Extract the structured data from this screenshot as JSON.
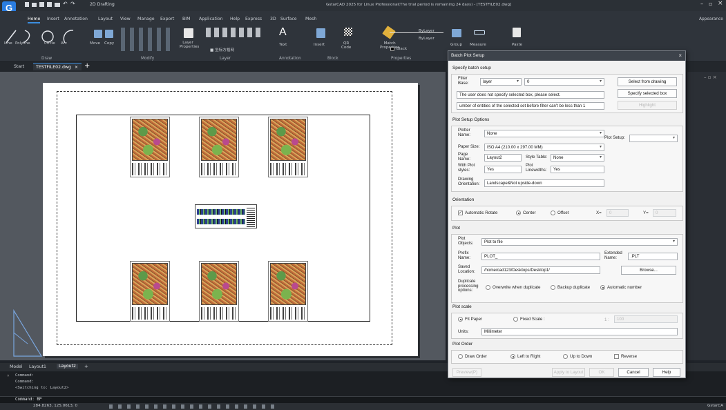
{
  "app": {
    "title": "GstarCAD 2025 for Linux Professional(The trial period is remaining 24 days) - [TESTFILE02.dwg]",
    "workspace": "2D Drafting",
    "appearance_label": "Appearance"
  },
  "ribbon": {
    "tabs": [
      "Home",
      "Insert",
      "Annotation",
      "Layout",
      "View",
      "Manage",
      "Export",
      "BIM",
      "Application",
      "Help",
      "Express",
      "3D",
      "Surface",
      "Mesh"
    ],
    "draw_tools": [
      "Line",
      "Polyline",
      "Circle",
      "Arc"
    ],
    "modify_tools": [
      "Move",
      "Copy"
    ],
    "layer_label": "Layer\nProperties",
    "layer_current": "■ 坐标方格网",
    "text_label": "Text",
    "insert_label": "Insert",
    "qr_label": "QR\nCode",
    "match_label": "Match\nProperties",
    "group_label": "Group",
    "measure_label": "Measure",
    "paste_label": "Paste",
    "bylayer_1": "ByLayer",
    "bylayer_2": "ByLayer",
    "color_value": "Black",
    "groups": [
      "Draw",
      "Modify",
      "Layer",
      "Annotation",
      "Block",
      "Properties"
    ]
  },
  "doctabs": {
    "start": "Start",
    "file": "TESTFILE02.dwg",
    "close": "×",
    "add": "+"
  },
  "layout_tabs": [
    "Model",
    "Layout1",
    "Layout2",
    "+"
  ],
  "command": {
    "history": [
      "Command:",
      "Command:",
      "<Switching to: Layout2>"
    ],
    "prompt": "Command: BP"
  },
  "status": {
    "coords": "284.8263, 125.0613, 0",
    "brand": "GstarCA"
  },
  "dialog": {
    "title": "Batch Plot Setup",
    "close": "×",
    "specify_section": "Specify batch setup",
    "filter_base_label": "Filter\nBase:",
    "filter_base_value": "layer",
    "filter_value": "0",
    "select_from_drawing": "Select from drawing",
    "specify_selected_box": "Specify selected box",
    "highlight": "Highlight",
    "message_1": "The user does not specify selected box, please select.",
    "message_2": "umber of entities of the selected set before filter can't be less than 1",
    "plot_setup_section": "Plot Setup Options",
    "plotter_name_label": "Plotter\nName:",
    "plotter_name_value": "None",
    "plot_setup_label": "Plot Setup:",
    "plot_setup_value": "",
    "paper_size_label": "Paper Size:",
    "paper_size_value": "ISO A4 (210.00 x 297.00 MM)",
    "page_name_label": "Page\nName:",
    "page_name_value": "Layout2",
    "style_table_label": "Style Table:",
    "style_table_value": "None",
    "with_plot_styles_label": "With Plot\nstyles:",
    "with_plot_styles_value": "Yes",
    "plot_linewidths_label": "Plot\nLinewidths:",
    "plot_linewidths_value": "Yes",
    "drawing_orientation_label": "Drawing\nOrientation:",
    "drawing_orientation_value": "Landscape&Not upside-down",
    "orientation_section": "Orientation",
    "automatic_rotate": "Automatic Rotate",
    "center": "Center",
    "offset": "Offset",
    "x_label": "X=",
    "x_value": "0",
    "y_label": "Y=",
    "y_value": "0",
    "plot_section": "Plot",
    "plot_objects_label": "Plot\nObjects:",
    "plot_objects_value": "Plot to file",
    "prefix_name_label": "Prefix\nName:",
    "prefix_name_value": "PLOT_",
    "extended_name_label": "Extended\nName:",
    "extended_name_value": ".PLT",
    "saved_location_label": "Saved\nLocation:",
    "saved_location_value": "/home/cad123/Desktops/Desktop1/",
    "browse": "Browse...",
    "duplicate_label": "Duplicate\nprocessing\noptions:",
    "overwrite": "Overwrite when duplicate",
    "backup": "Backup duplicate",
    "automatic_number": "Automatic number",
    "plot_scale_section": "Plot scale",
    "fit_paper": "Fit Paper",
    "fixed_scale": "Fixed Scale :",
    "scale_separator": "1 :",
    "scale_value": "100",
    "units_label": "Units:",
    "units_value": "Millimeter",
    "plot_order_section": "Plot Order",
    "draw_order": "Draw Order",
    "left_to_right": "Left to Right",
    "up_to_down": "Up to Down",
    "reverse": "Reverse",
    "preview": "Preview(P)",
    "apply_to_layout": "Apply to Layout",
    "ok": "OK",
    "cancel": "Cancel",
    "help": "Help"
  },
  "colors": {
    "dialog_bg": "#f1f1f1",
    "ribbon_bg": "#2f343b",
    "canvas_bg": "#53585f",
    "accent": "#3b8ee0"
  }
}
